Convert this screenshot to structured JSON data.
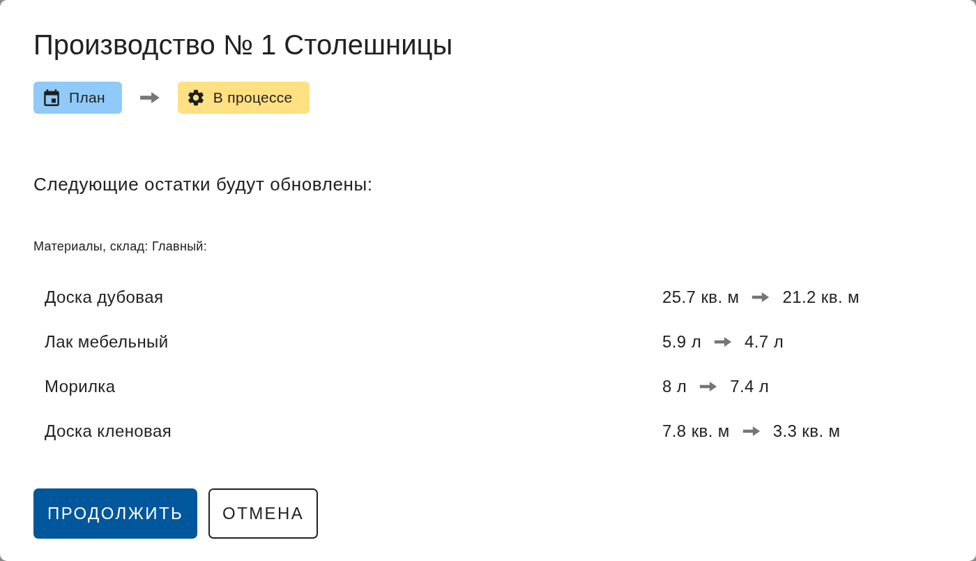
{
  "title": "Производство № 1 Столешницы",
  "status_change": [
    {
      "label": "План",
      "kind": "plan",
      "color": "#90caf9"
    },
    {
      "label": "В процессе",
      "kind": "progress",
      "color": "#ffe082"
    }
  ],
  "subtitle": "Следующие остатки будут обновлены:",
  "section": {
    "label": "Материалы, склад: Главный:",
    "items": [
      {
        "name": "Доска дубовая",
        "from": "25.7 кв. м",
        "to": "21.2 кв. м"
      },
      {
        "name": "Лак мебельный",
        "from": "5.9 л",
        "to": "4.7 л"
      },
      {
        "name": "Морилка",
        "from": "8 л",
        "to": "7.4 л"
      },
      {
        "name": "Доска кленовая",
        "from": "7.8 кв. м",
        "to": "3.3 кв. м"
      }
    ]
  },
  "buttons": [
    {
      "label": "ПРОДОЛЖИТЬ",
      "kind": "primary"
    },
    {
      "label": "ОТМЕНА",
      "kind": "outlined"
    }
  ]
}
